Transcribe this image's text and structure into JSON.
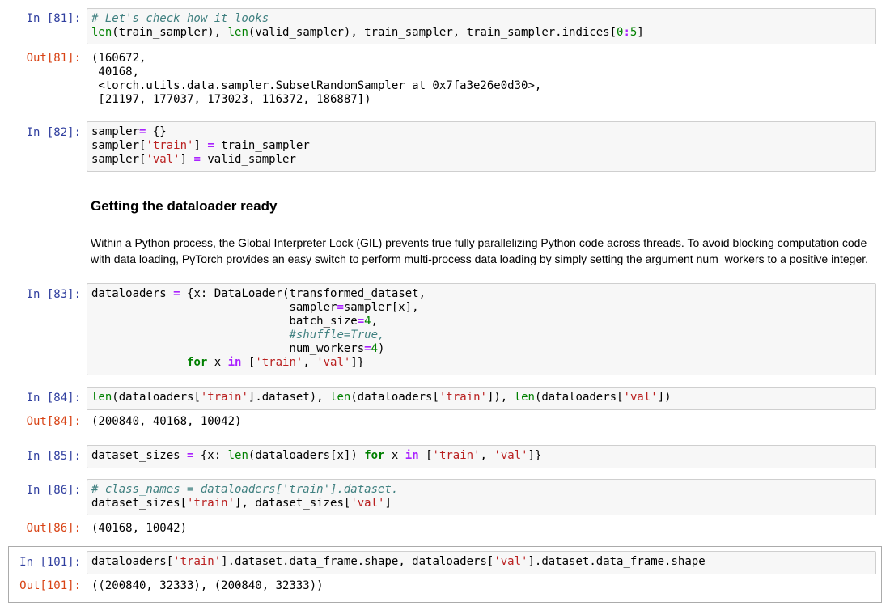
{
  "cells": {
    "c81": {
      "in_prompt": "In [81]:",
      "out_prompt": "Out[81]:",
      "code": {
        "l1": "# Let's check how it looks",
        "l2_a": "len",
        "l2_b": "(train_sampler), ",
        "l2_c": "len",
        "l2_d": "(valid_sampler), train_sampler, train_sampler.indices[",
        "l2_e": "0",
        "l2_f": ":",
        "l2_g": "5",
        "l2_h": "]"
      },
      "output": "(160672,\n 40168,\n <torch.utils.data.sampler.SubsetRandomSampler at 0x7fa3e26e0d30>,\n [21197, 177037, 173023, 116372, 186887])"
    },
    "c82": {
      "in_prompt": "In [82]:",
      "code": {
        "l1_a": "sampler",
        "l1_b": "=",
        "l1_c": " {}",
        "l2_a": "sampler[",
        "l2_b": "'train'",
        "l2_c": "] ",
        "l2_d": "=",
        "l2_e": " train_sampler",
        "l3_a": "sampler[",
        "l3_b": "'val'",
        "l3_c": "] ",
        "l3_d": "=",
        "l3_e": " valid_sampler"
      }
    },
    "markdown": {
      "heading": "Getting the dataloader ready",
      "paragraph": "Within a Python process, the Global Interpreter Lock (GIL) prevents true fully parallelizing Python code across threads. To avoid blocking computation code with data loading, PyTorch provides an easy switch to perform multi-process data loading by simply setting the argument num_workers to a positive integer."
    },
    "c83": {
      "in_prompt": "In [83]:",
      "code": {
        "l1_a": "dataloaders ",
        "l1_b": "=",
        "l1_c": " {x: DataLoader(transformed_dataset,",
        "l2_a": "                             sampler",
        "l2_b": "=",
        "l2_c": "sampler[x],",
        "l3_a": "                             batch_size",
        "l3_b": "=",
        "l3_c": "4",
        "l3_d": ",",
        "l4_a": "                             ",
        "l4_b": "#shuffle=True,",
        "l5_a": "                             num_workers",
        "l5_b": "=",
        "l5_c": "4",
        "l5_d": ")",
        "l6_a": "              ",
        "l6_b": "for",
        "l6_c": " x ",
        "l6_d": "in",
        "l6_e": " [",
        "l6_f": "'train'",
        "l6_g": ", ",
        "l6_h": "'val'",
        "l6_i": "]}"
      }
    },
    "c84": {
      "in_prompt": "In [84]:",
      "out_prompt": "Out[84]:",
      "code": {
        "a": "len",
        "b": "(dataloaders[",
        "c": "'train'",
        "d": "].dataset), ",
        "e": "len",
        "f": "(dataloaders[",
        "g": "'train'",
        "h": "]), ",
        "i": "len",
        "j": "(dataloaders[",
        "k": "'val'",
        "l": "])"
      },
      "output": "(200840, 40168, 10042)"
    },
    "c85": {
      "in_prompt": "In [85]:",
      "code": {
        "a": "dataset_sizes ",
        "b": "=",
        "c": " {x: ",
        "d": "len",
        "e": "(dataloaders[x]) ",
        "f": "for",
        "g": " x ",
        "h": "in",
        "i": " [",
        "j": "'train'",
        "k": ", ",
        "l": "'val'",
        "m": "]}"
      }
    },
    "c86": {
      "in_prompt": "In [86]:",
      "out_prompt": "Out[86]:",
      "code": {
        "l1": "# class_names = dataloaders['train'].dataset.",
        "l2_a": "dataset_sizes[",
        "l2_b": "'train'",
        "l2_c": "], dataset_sizes[",
        "l2_d": "'val'",
        "l2_e": "]"
      },
      "output": "(40168, 10042)"
    },
    "c101": {
      "in_prompt": "In [101]:",
      "out_prompt": "Out[101]:",
      "code": {
        "a": "dataloaders[",
        "b": "'train'",
        "c": "].dataset.data_frame.shape, dataloaders[",
        "d": "'val'",
        "e": "].dataset.data_frame.shape"
      },
      "output": "((200840, 32333), (200840, 32333))"
    }
  }
}
